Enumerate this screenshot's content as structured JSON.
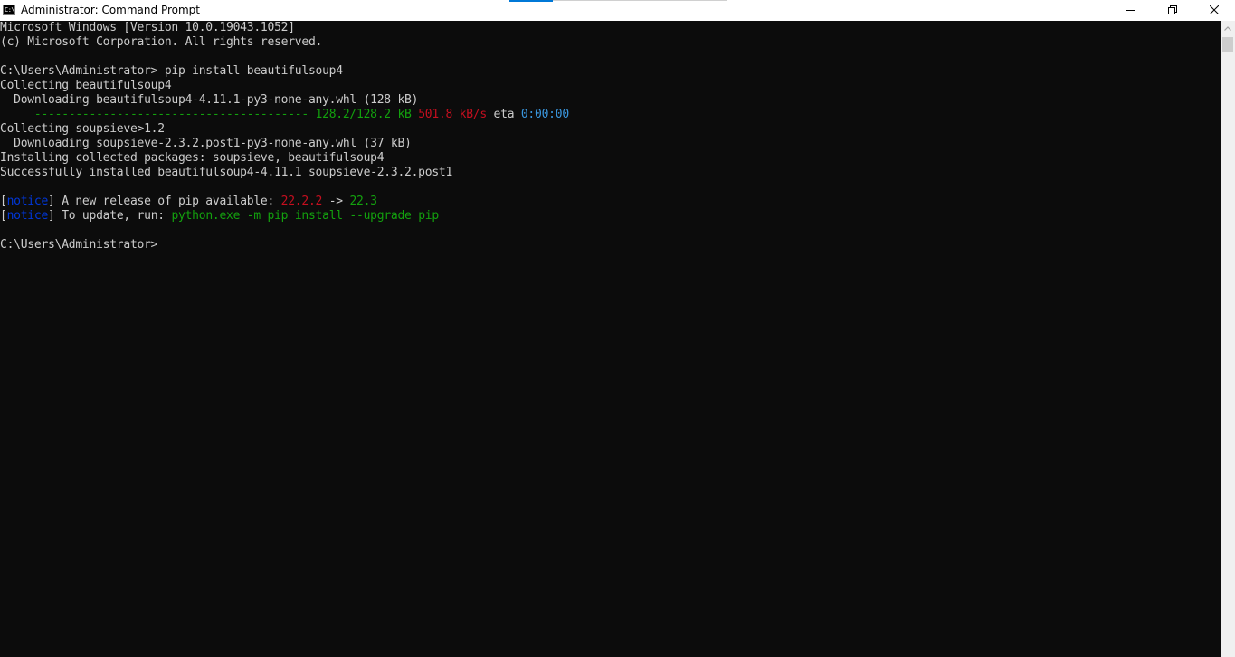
{
  "window": {
    "title": "Administrator: Command Prompt",
    "icon_label": "C:\\"
  },
  "controls": {
    "minimize": "minimize-icon",
    "maximize": "restore-icon",
    "close": "close-icon"
  },
  "colors": {
    "background": "#0c0c0c",
    "text": "#cccccc",
    "green": "#13a10e",
    "red": "#c50f1f",
    "blue": "#3a96dd",
    "dark_blue": "#0037da"
  },
  "console": {
    "header_version": "Microsoft Windows [Version 10.0.19043.1052]",
    "header_copyright": "(c) Microsoft Corporation. All rights reserved.",
    "prompt_1": "C:\\Users\\Administrator>",
    "command_1": " pip install beautifulsoup4",
    "collecting_1": "Collecting beautifulsoup4",
    "downloading_1": "  Downloading beautifulsoup4-4.11.1-py3-none-any.whl (128 kB)",
    "progress_indent": "     ",
    "progress_bar": "----------------------------------------",
    "progress_size": " 128.2/128.2 kB",
    "progress_speed": " 501.8 kB/s",
    "progress_eta_label": " eta ",
    "progress_eta": "0:00:00",
    "collecting_2": "Collecting soupsieve>1.2",
    "downloading_2": "  Downloading soupsieve-2.3.2.post1-py3-none-any.whl (37 kB)",
    "installing": "Installing collected packages: soupsieve, beautifulsoup4",
    "success": "Successfully installed beautifulsoup4-4.11.1 soupsieve-2.3.2.post1",
    "notice_open": "[",
    "notice_word": "notice",
    "notice_close": "]",
    "notice_1_text": " A new release of pip available: ",
    "notice_1_old": "22.2.2",
    "notice_1_arrow": " -> ",
    "notice_1_new": "22.3",
    "notice_2_text": " To update, run: ",
    "notice_2_cmd": "python.exe -m pip install --upgrade pip",
    "prompt_2": "C:\\Users\\Administrator>"
  }
}
